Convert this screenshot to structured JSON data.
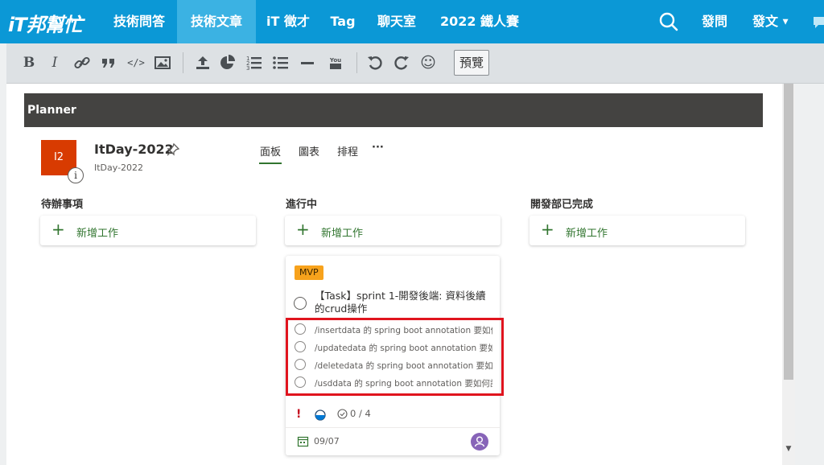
{
  "site": {
    "logo": "iT邦幫忙",
    "nav": [
      {
        "label": "技術問答",
        "active": false
      },
      {
        "label": "技術文章",
        "active": true
      },
      {
        "label": "iT 徵才",
        "active": false
      },
      {
        "label": "Tag",
        "active": false
      },
      {
        "label": "聊天室",
        "active": false
      },
      {
        "label": "2022 鐵人賽",
        "active": false
      }
    ],
    "ask": "發問",
    "post": "發文",
    "nav_color": "#0b98d6",
    "nav_active_color": "#3bb2e3"
  },
  "toolbar": {
    "icons": [
      "bold-icon",
      "italic-icon",
      "link-icon",
      "quote-icon",
      "code-icon",
      "image-icon",
      "upload-icon",
      "chart-icon",
      "ordered-list-icon",
      "unordered-list-icon",
      "horizontal-rule-icon",
      "youtube-icon",
      "undo-icon",
      "redo-icon",
      "emoji-icon"
    ],
    "bold": "B",
    "italic": "I",
    "code": "</>",
    "youtube": "You",
    "emoji": "☺",
    "preview": "預覽"
  },
  "planner": {
    "header": "Planner",
    "plan_initials": "I2",
    "info": "i",
    "plan_title": "ItDay-2022",
    "plan_subtitle": "ItDay-2022",
    "tabs": [
      {
        "label": "面板",
        "active": true
      },
      {
        "label": "圖表",
        "active": false
      },
      {
        "label": "排程",
        "active": false
      },
      {
        "label": "···",
        "active": false
      }
    ],
    "buckets": [
      {
        "title": "待辦事項",
        "add_label": "新增工作"
      },
      {
        "title": "進行中",
        "add_label": "新增工作"
      },
      {
        "title": "開發部已完成",
        "add_label": "新增工作"
      }
    ],
    "accent_color": "#31752f",
    "task": {
      "label": "MVP",
      "label_color": "#f7a21c",
      "title": "【Task】sprint 1-開發後端: 資料後續的crud操作",
      "checklist": [
        "/insertdata 的 spring boot annotation 要如何",
        "/updatedata 的 spring boot annotation 要如何",
        "/deletedata 的 spring boot annotation 要如何",
        "/usddata 的 spring boot annotation 要如何設"
      ],
      "priority": "!",
      "checklist_done": 0,
      "checklist_total": 4,
      "checklist_count": "0 / 4",
      "due": "09/07",
      "highlight_color": "#e0141e"
    }
  }
}
